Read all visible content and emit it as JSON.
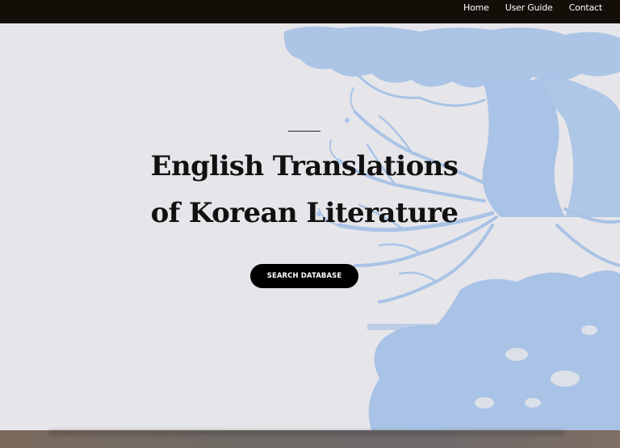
{
  "nav": {
    "items": [
      {
        "label": "Home"
      },
      {
        "label": "User Guide"
      },
      {
        "label": "Contact"
      }
    ]
  },
  "hero": {
    "title_line1": "English Translations",
    "title_line2": "of Korean Literature",
    "cta_label": "SEARCH DATABASE"
  },
  "colors": {
    "topbar": "#130e08",
    "background": "#e6e6ea",
    "tree": "#a9c3e6",
    "button": "#000000"
  },
  "icons": {
    "hero_image": "tree-roots-illustration"
  }
}
